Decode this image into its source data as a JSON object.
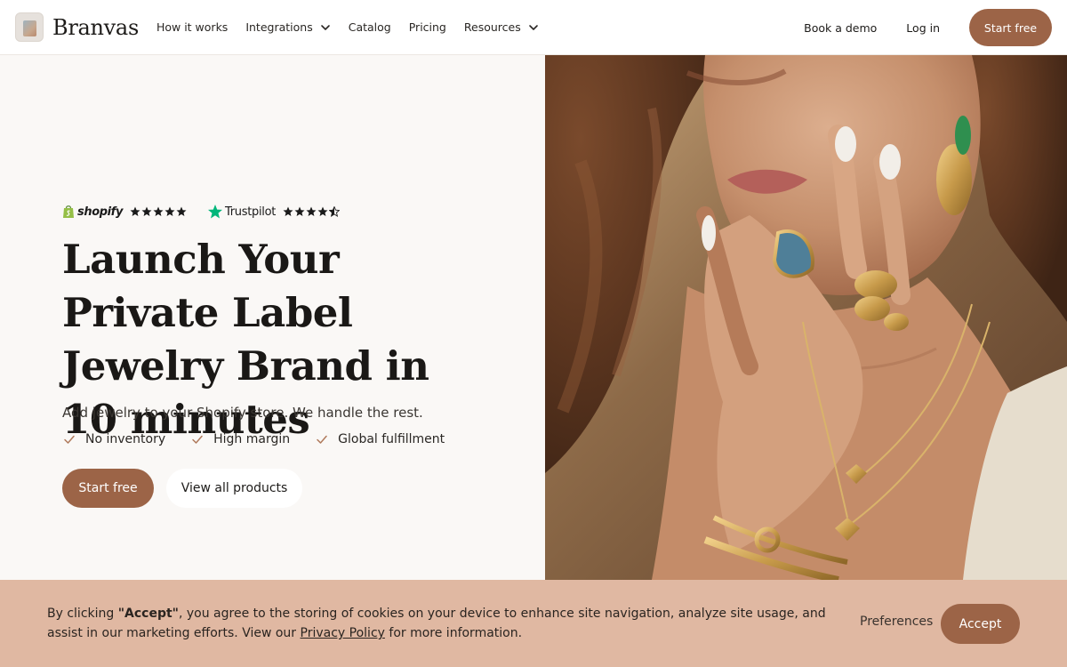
{
  "header": {
    "brand": "Branvas",
    "nav": [
      {
        "label": "How it works",
        "dropdown": false
      },
      {
        "label": "Integrations",
        "dropdown": true
      },
      {
        "label": "Catalog",
        "dropdown": false
      },
      {
        "label": "Pricing",
        "dropdown": false
      },
      {
        "label": "Resources",
        "dropdown": true
      }
    ],
    "book_demo": "Book a demo",
    "login": "Log in",
    "start_free": "Start free"
  },
  "hero": {
    "shopify_label": "shopify",
    "shopify_rating": 5,
    "trustpilot_label": "Trustpilot",
    "trustpilot_rating": 4.5,
    "headline": "Launch Your Private Label Jewelry Brand in 10 minutes",
    "subheadline": "Add jewelry to your Shopify store. We handle the rest.",
    "features": [
      "No inventory",
      "High margin",
      "Global fulfillment"
    ],
    "primary_cta": "Start free",
    "secondary_cta": "View all products"
  },
  "cookie": {
    "text_prefix": "By clicking ",
    "text_bold": "\"Accept\"",
    "text_main": ", you agree to the storing of cookies on your device to enhance site navigation, analyze site usage, and assist in our marketing efforts. View our ",
    "link": "Privacy Policy",
    "text_suffix": " for more information.",
    "preferences": "Preferences",
    "accept": "Accept"
  },
  "colors": {
    "accent": "#9c6447",
    "cookie_bg": "#e0b8a2",
    "page_bg": "#faf8f6",
    "trustpilot_green": "#00b67a",
    "shopify_green": "#95bf47"
  },
  "icons": {
    "dropdown": "chevron-down-icon",
    "feature": "check-icon",
    "rating": "star-icon"
  }
}
